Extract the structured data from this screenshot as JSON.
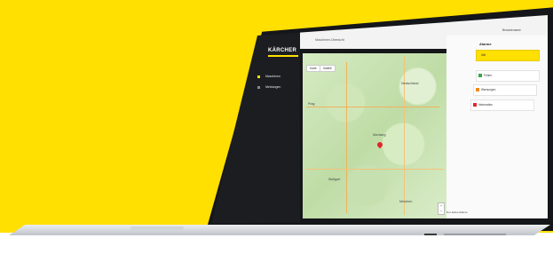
{
  "scene": {
    "background_color": "#ffe000",
    "accent_color": "#ffe000",
    "marker_color": "#e3262b"
  },
  "app": {
    "brand": "KÄRCHER",
    "nav": [
      {
        "label": "Maschinen"
      },
      {
        "label": "Meldungen"
      }
    ],
    "top": {
      "title": "Maschinen-Übersicht",
      "user": "Benutzername"
    },
    "map": {
      "map_button": "Karte",
      "satellite_button": "Satellit",
      "labels": [
        "Prag",
        "Deutschland",
        "Nürnberg",
        "Stuttgart",
        "München"
      ],
      "zoom_in": "+",
      "zoom_out": "−"
    },
    "alerts": {
      "title": "Alarme",
      "items": [
        {
          "label": "Alle"
        },
        {
          "label": "Fehler"
        },
        {
          "label": "Warnungen"
        },
        {
          "label": "Information"
        }
      ],
      "checkbox": "Nur aktive Alarme"
    }
  }
}
